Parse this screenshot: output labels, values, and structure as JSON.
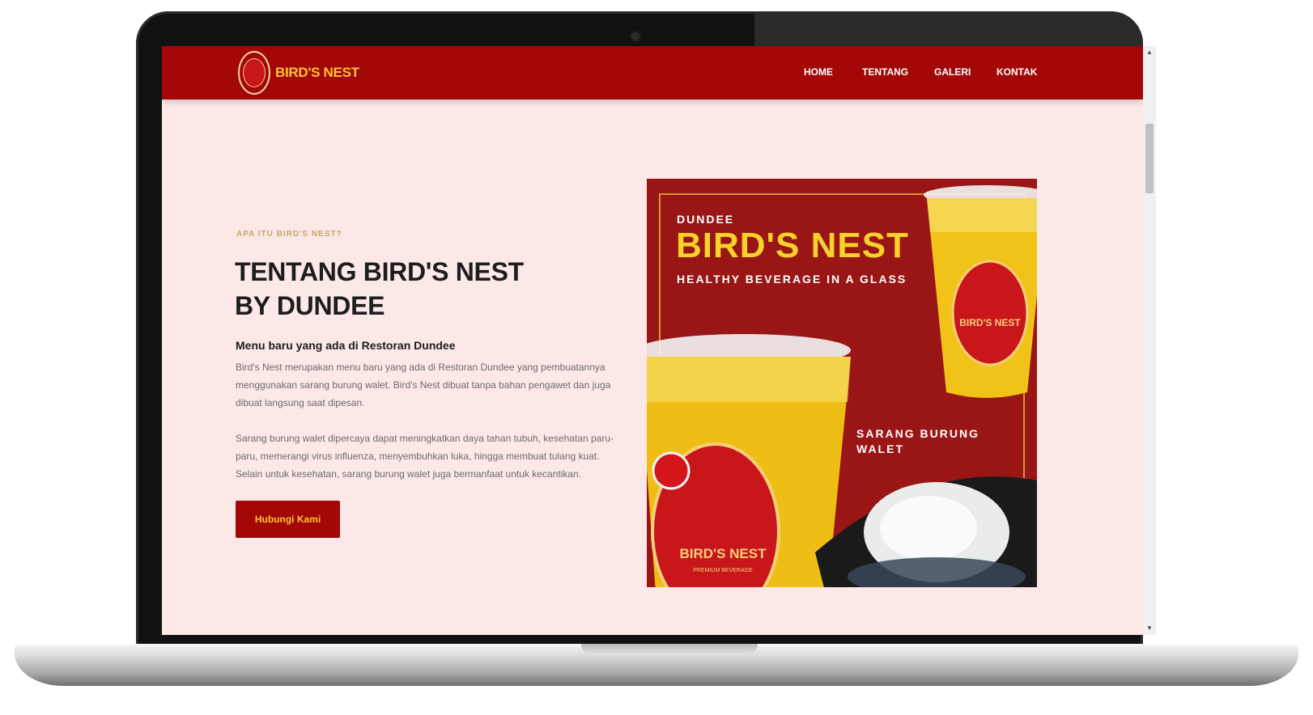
{
  "brand": {
    "logo_text": "BIRD'S NEST",
    "primary_color": "#a30707",
    "accent_color": "#f7c531"
  },
  "nav": {
    "items": [
      {
        "label": "HOME"
      },
      {
        "label": "TENTANG"
      },
      {
        "label": "GALERI"
      },
      {
        "label": "KONTAK"
      }
    ]
  },
  "about": {
    "eyebrow": "APA ITU BIRD'S NEST?",
    "heading_line1": "TENTANG BIRD'S NEST",
    "heading_line2": "BY DUNDEE",
    "subheading": "Menu baru yang ada di Restoran Dundee",
    "paragraph1": "Bird's Nest merupakan menu baru yang ada di Restoran Dundee yang pembuatannya menggunakan sarang burung walet. Bird's Nest dibuat tanpa bahan pengawet dan juga dibuat langsung saat dipesan.",
    "paragraph2": "Sarang burung walet dipercaya dapat meningkatkan daya tahan tubuh, kesehatan paru-paru, memerangi virus influenza, menyembuhkan luka, hingga membuat tulang kuat. Selain untuk kesehatan, sarang burung walet juga bermanfaat untuk kecantikan.",
    "cta_label": "Hubungi Kami"
  },
  "promo_image": {
    "brand": "DUNDEE",
    "title": "BIRD'S NEST",
    "tagline": "HEALTHY BEVERAGE IN A GLASS",
    "caption": "SARANG BURUNG WALET",
    "cup_label": "BIRD'S NEST",
    "cup_sublabel": "PREMIUM BEVERAGE"
  },
  "scrollbar": {
    "up_icon": "triangle-up",
    "down_icon": "triangle-down"
  }
}
